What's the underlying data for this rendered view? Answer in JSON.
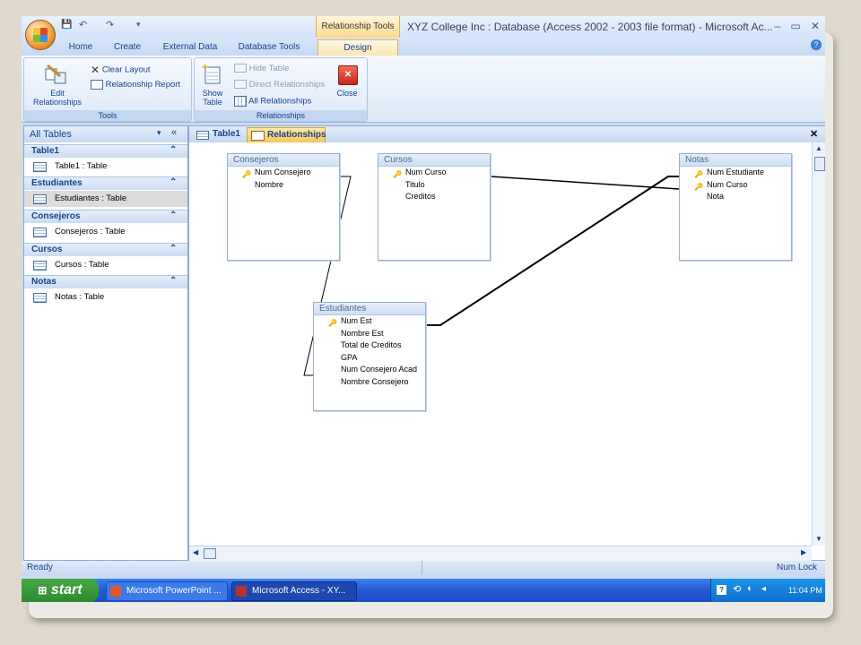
{
  "window": {
    "title": "XYZ College Inc : Database (Access 2002 - 2003 file format) - Microsoft Ac...",
    "context_tab": "Relationship Tools",
    "controls": {
      "minimize": "–",
      "restore": "▭",
      "close": "✕"
    }
  },
  "quick_access": {
    "save": "💾",
    "undo": "↶",
    "redo": "↷",
    "more": "▾"
  },
  "ribbon_tabs": [
    "Home",
    "Create",
    "External Data",
    "Database Tools",
    "Design"
  ],
  "ribbon_active_tab": "Design",
  "ribbon": {
    "tools_group": {
      "label": "Tools",
      "edit_relationships": "Edit Relationships",
      "clear_layout": "Clear Layout",
      "relationship_report": "Relationship Report"
    },
    "relationships_group": {
      "label": "Relationships",
      "show_table": "Show Table",
      "hide_table": "Hide Table",
      "direct_relationships": "Direct Relationships",
      "all_relationships": "All Relationships",
      "close": "Close"
    }
  },
  "nav_pane": {
    "header": "All Tables",
    "groups": [
      {
        "name": "Table1",
        "item": "Table1 : Table"
      },
      {
        "name": "Estudiantes",
        "item": "Estudiantes : Table"
      },
      {
        "name": "Consejeros",
        "item": "Consejeros : Table"
      },
      {
        "name": "Cursos",
        "item": "Cursos : Table"
      },
      {
        "name": "Notas",
        "item": "Notas : Table"
      }
    ]
  },
  "doc_tabs": [
    "Table1",
    "Relationships"
  ],
  "doc_active_tab": "Relationships",
  "tables": {
    "consejeros": {
      "title": "Consejeros",
      "fields": [
        "Num Consejero",
        "Nombre"
      ]
    },
    "cursos": {
      "title": "Cursos",
      "fields": [
        "Num Curso",
        "Titulo",
        "Creditos"
      ]
    },
    "notas": {
      "title": "Notas",
      "fields": [
        "Num Estudiante",
        "Num Curso",
        "Nota"
      ]
    },
    "estudiantes": {
      "title": "Estudiantes",
      "fields": [
        "Num Est",
        "Nombre Est",
        "Total de Creditos",
        "GPA",
        "Num Consejero Acad",
        "Nombre Consejero"
      ]
    }
  },
  "status_bar": {
    "left": "Ready",
    "right": "Num Lock"
  },
  "taskbar": {
    "start": "start",
    "items": [
      "Microsoft PowerPoint ...",
      "Microsoft Access - XY..."
    ],
    "clock": "11:04 PM"
  },
  "colors": {
    "accent": "#15428b",
    "taskbar": "#245edb",
    "start": "#3c9a3a"
  }
}
